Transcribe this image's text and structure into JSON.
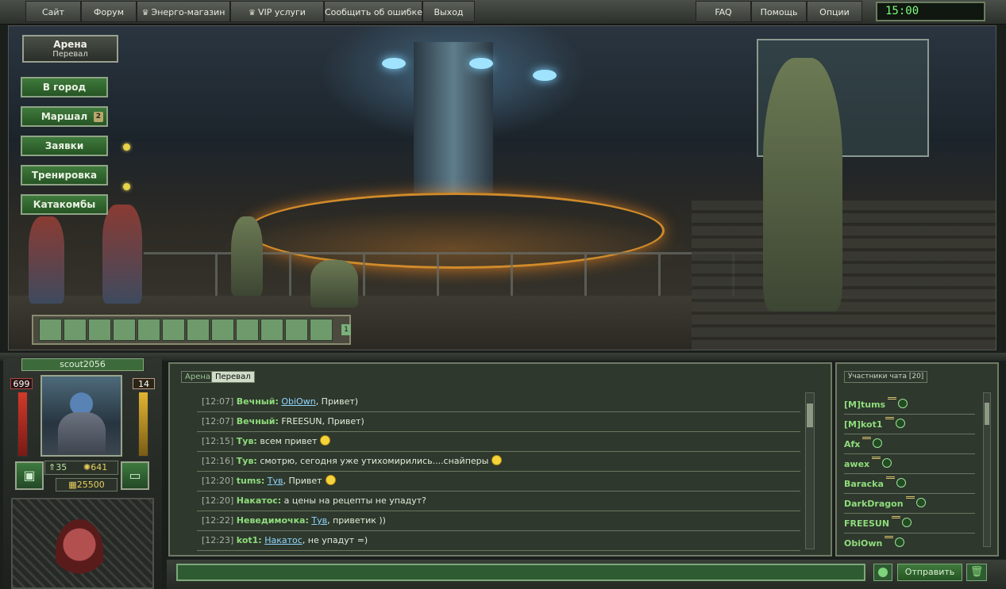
{
  "topbar": {
    "left_items": [
      {
        "label": "Сайт",
        "crown": false
      },
      {
        "label": "Форум",
        "crown": false
      },
      {
        "label": "Энерго-магазин",
        "crown": true
      },
      {
        "label": "VIP услуги",
        "crown": true
      },
      {
        "label": "Сообщить об ошибке",
        "crown": false
      },
      {
        "label": "Выход",
        "crown": false
      }
    ],
    "right_items": [
      {
        "label": "FAQ"
      },
      {
        "label": "Помощь"
      },
      {
        "label": "Опции"
      }
    ],
    "clock": "15:00"
  },
  "location": {
    "name": "Арена",
    "sub": "Перевал"
  },
  "nav": [
    {
      "label": "В город"
    },
    {
      "label": "Маршал",
      "badge": "2"
    },
    {
      "label": "Заявки"
    },
    {
      "label": "Тренировка"
    },
    {
      "label": "Катакомбы"
    }
  ],
  "inventory": {
    "page": "1"
  },
  "player": {
    "name": "scout2056",
    "hp": "699",
    "energy": "14",
    "stat_a": "35",
    "stat_b": "641",
    "money": "25500"
  },
  "chat": {
    "tabs": [
      "Арена",
      "Перевал"
    ],
    "active_tab": "Перевал",
    "messages": [
      {
        "time": "[12:07]",
        "nick": "Вечный:",
        "parts": [
          {
            "t": " "
          },
          {
            "t": "ObiOwn",
            "link": true
          },
          {
            "t": ", Привет)"
          }
        ],
        "smile": false
      },
      {
        "time": "[12:07]",
        "nick": "Вечный:",
        "parts": [
          {
            "t": " FREESUN, Привет)"
          }
        ],
        "smile": false
      },
      {
        "time": "[12:15]",
        "nick": "Тув:",
        "parts": [
          {
            "t": " всем привет"
          }
        ],
        "smile": true
      },
      {
        "time": "[12:16]",
        "nick": "Тув:",
        "parts": [
          {
            "t": " смотрю, сегодня уже утихомирились....снайперы"
          }
        ],
        "smile": true
      },
      {
        "time": "[12:20]",
        "nick": "tums:",
        "parts": [
          {
            "t": " "
          },
          {
            "t": "Тув",
            "link": true
          },
          {
            "t": ", Привет"
          }
        ],
        "smile": true
      },
      {
        "time": "[12:20]",
        "nick": "Накатос:",
        "parts": [
          {
            "t": " а цены на рецепты не упадут?"
          }
        ],
        "smile": false
      },
      {
        "time": "[12:22]",
        "nick": "Неведимочка:",
        "parts": [
          {
            "t": " "
          },
          {
            "t": "Тув",
            "link": true
          },
          {
            "t": ", приветик ))"
          }
        ],
        "smile": false
      },
      {
        "time": "[12:23]",
        "nick": "kot1:",
        "parts": [
          {
            "t": " "
          },
          {
            "t": "Накатос",
            "link": true
          },
          {
            "t": ", не упадут =)"
          }
        ],
        "smile": false
      }
    ],
    "input_value": "",
    "send_label": "Отправить"
  },
  "participants": {
    "title": "Участники чата [20]",
    "users": [
      "[M]tums",
      "[M]kot1",
      "Afx",
      "awex",
      "Baracka",
      "DarkDragon",
      "FREESUN",
      "ObiOwn"
    ]
  },
  "colors": {
    "accent_green": "#3f7a3c",
    "nick_green": "#8fdc7c",
    "link_blue": "#8fd6ff",
    "clock_green": "#7dff7d"
  }
}
